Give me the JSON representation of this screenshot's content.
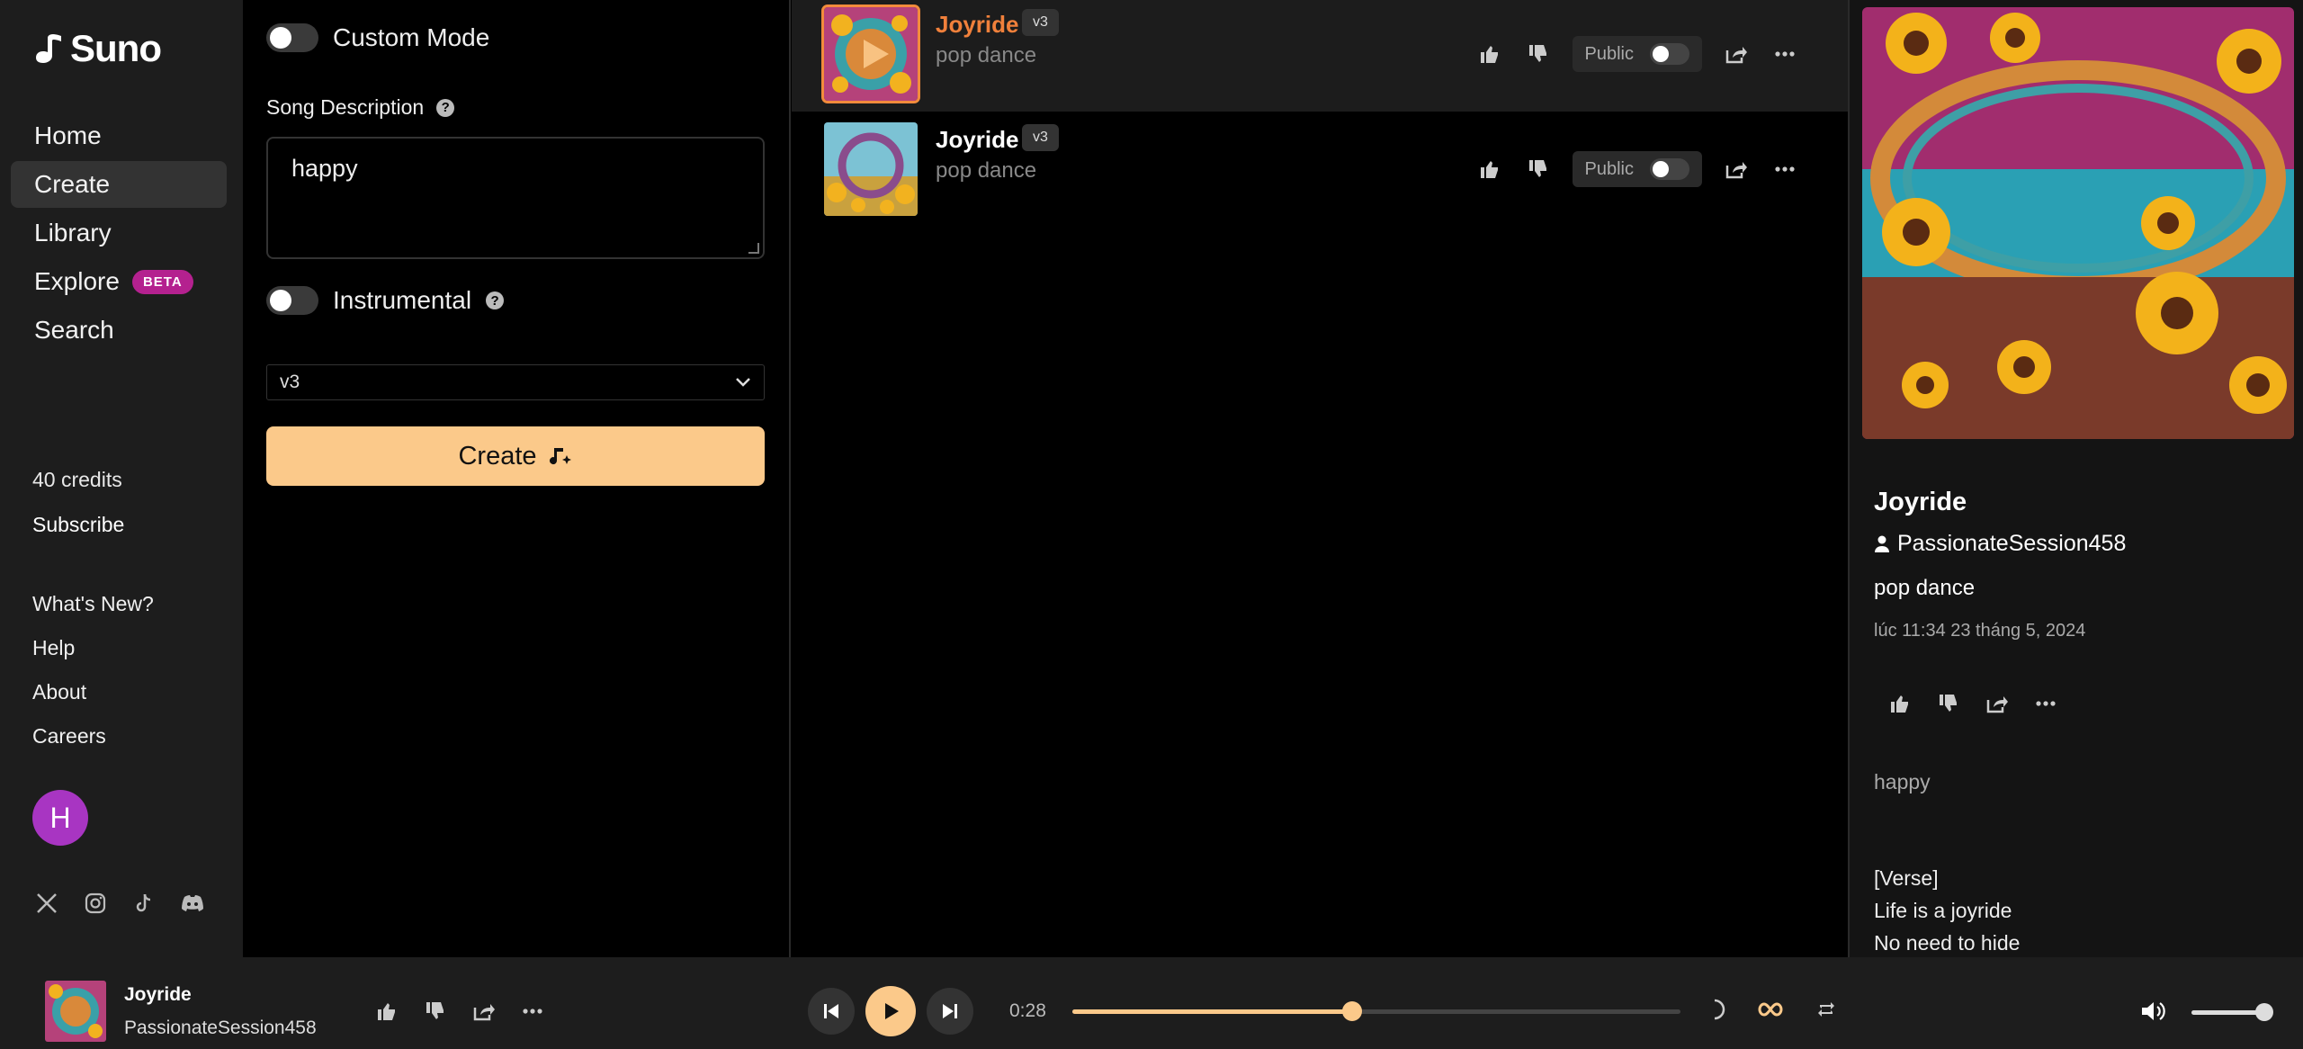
{
  "brand": {
    "name": "Suno"
  },
  "sidebar": {
    "nav": [
      {
        "label": "Home",
        "active": false
      },
      {
        "label": "Create",
        "active": true
      },
      {
        "label": "Library",
        "active": false
      },
      {
        "label": "Explore",
        "active": false,
        "badge": "BETA"
      },
      {
        "label": "Search",
        "active": false
      }
    ],
    "credits": "40 credits",
    "subscribe": "Subscribe",
    "links": [
      "What's New?",
      "Help",
      "About",
      "Careers"
    ],
    "avatar_initial": "H",
    "socials": [
      "x-icon",
      "instagram-icon",
      "tiktok-icon",
      "discord-icon"
    ]
  },
  "create": {
    "custom_mode_label": "Custom Mode",
    "custom_mode_on": false,
    "description_label": "Song Description",
    "description_value": "happy",
    "instrumental_label": "Instrumental",
    "instrumental_on": false,
    "model_selected": "v3",
    "create_label": "Create"
  },
  "songs": [
    {
      "title": "Joyride",
      "version": "v3",
      "style": "pop dance",
      "public_label": "Public",
      "selected": true,
      "playing": true
    },
    {
      "title": "Joyride",
      "version": "v3",
      "style": "pop dance",
      "public_label": "Public",
      "selected": false,
      "playing": false
    }
  ],
  "detail": {
    "title": "Joyride",
    "user": "PassionateSession458",
    "style": "pop dance",
    "date": "lúc 11:34 23 tháng 5, 2024",
    "prompt": "happy",
    "lyrics": [
      "[Verse]",
      "Life is a joyride",
      "No need to hide"
    ]
  },
  "player": {
    "title": "Joyride",
    "artist": "PassionateSession458",
    "time": "0:28",
    "progress": 0.46,
    "volume": 0.9
  },
  "colors": {
    "accent": "#fbc98a",
    "title_orange": "#f0803b",
    "beta": "#b4218f",
    "avatar": "#a835c2"
  }
}
